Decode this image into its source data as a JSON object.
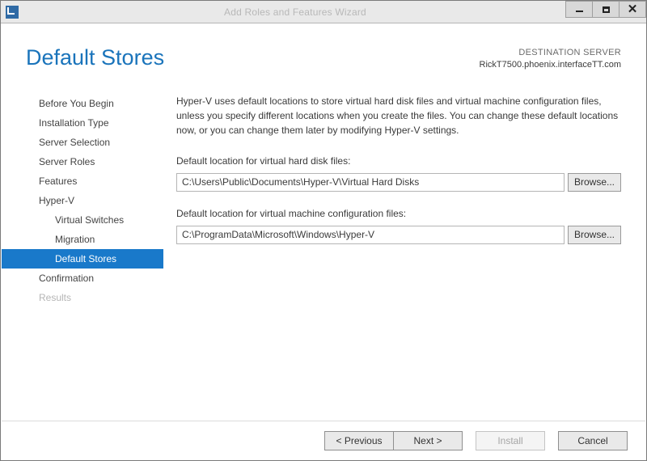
{
  "window": {
    "title": "Add Roles and Features Wizard"
  },
  "header": {
    "page_title": "Default Stores",
    "dest_label": "DESTINATION SERVER",
    "dest_server": "RickT7500.phoenix.interfaceTT.com"
  },
  "sidebar": {
    "items": [
      {
        "label": "Before You Begin",
        "sub": false,
        "selected": false,
        "disabled": false
      },
      {
        "label": "Installation Type",
        "sub": false,
        "selected": false,
        "disabled": false
      },
      {
        "label": "Server Selection",
        "sub": false,
        "selected": false,
        "disabled": false
      },
      {
        "label": "Server Roles",
        "sub": false,
        "selected": false,
        "disabled": false
      },
      {
        "label": "Features",
        "sub": false,
        "selected": false,
        "disabled": false
      },
      {
        "label": "Hyper-V",
        "sub": false,
        "selected": false,
        "disabled": false
      },
      {
        "label": "Virtual Switches",
        "sub": true,
        "selected": false,
        "disabled": false
      },
      {
        "label": "Migration",
        "sub": true,
        "selected": false,
        "disabled": false
      },
      {
        "label": "Default Stores",
        "sub": true,
        "selected": true,
        "disabled": false
      },
      {
        "label": "Confirmation",
        "sub": false,
        "selected": false,
        "disabled": false
      },
      {
        "label": "Results",
        "sub": false,
        "selected": false,
        "disabled": true
      }
    ]
  },
  "content": {
    "intro": "Hyper-V uses default locations to store virtual hard disk files and virtual machine configuration files, unless you specify different locations when you create the files. You can change these default locations now, or you can change them later by modifying Hyper-V settings.",
    "vhd_label": "Default location for virtual hard disk files:",
    "vhd_path": "C:\\Users\\Public\\Documents\\Hyper-V\\Virtual Hard Disks",
    "vm_label": "Default location for virtual machine configuration files:",
    "vm_path": "C:\\ProgramData\\Microsoft\\Windows\\Hyper-V",
    "browse": "Browse..."
  },
  "footer": {
    "previous": "< Previous",
    "next": "Next >",
    "install": "Install",
    "cancel": "Cancel"
  }
}
